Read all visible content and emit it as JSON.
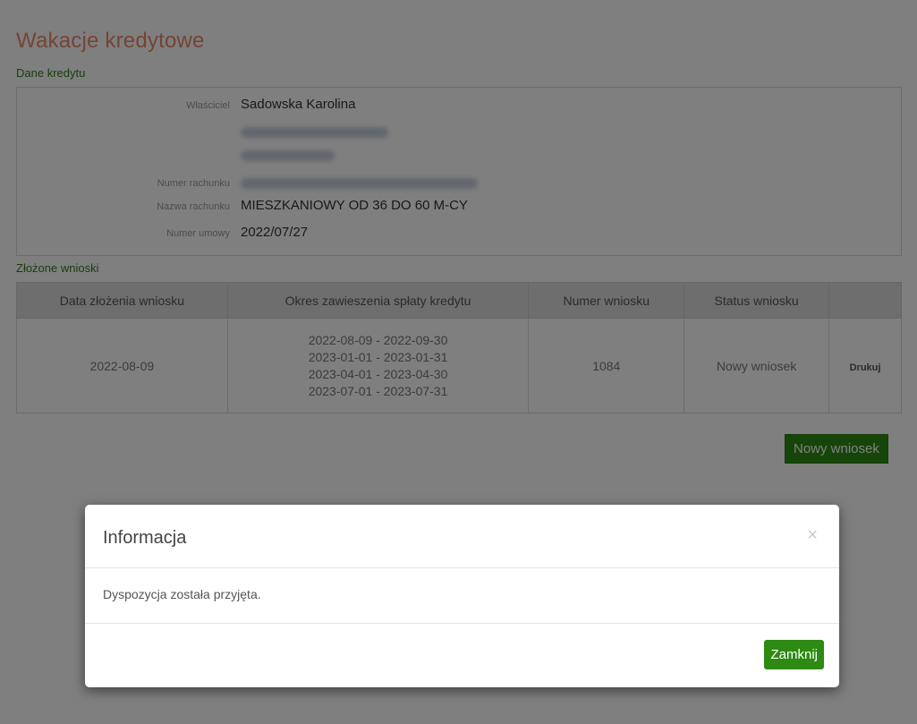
{
  "page": {
    "title": "Wakacje kredytowe",
    "loan_section_label": "Dane kredytu",
    "applications_section_label": "Złożone wnioski",
    "new_application_button": "Nowy wniosek"
  },
  "loan": {
    "owner_label": "Właściciel",
    "owner_value": "Sadowska Karolina",
    "account_number_label": "Numer rachunku",
    "account_name_label": "Nazwa rachunku",
    "account_name_value": "MIESZKANIOWY OD 36 DO 60 M-CY",
    "contract_number_label": "Numer umowy",
    "contract_number_value": "2022/07/27"
  },
  "applications": {
    "headers": [
      "Data złożenia wniosku",
      "Okres zawieszenia spłaty kredytu",
      "Numer wniosku",
      "Status wniosku",
      ""
    ],
    "rows": [
      {
        "date": "2022-08-09",
        "periods": [
          "2022-08-09 - 2022-09-30",
          "2023-01-01 - 2023-01-31",
          "2023-04-01 - 2023-04-30",
          "2023-07-01 - 2023-07-31"
        ],
        "number": "1084",
        "status": "Nowy wniosek",
        "action": "Drukuj"
      }
    ]
  },
  "modal": {
    "title": "Informacja",
    "close_symbol": "×",
    "message": "Dyspozycja została przyjęta.",
    "button": "Zamknij"
  },
  "colors": {
    "title": "#e8896a",
    "section": "#2f7d1f",
    "button": "#2d8a12",
    "overlay": "rgba(0,0,0,0.5)"
  }
}
